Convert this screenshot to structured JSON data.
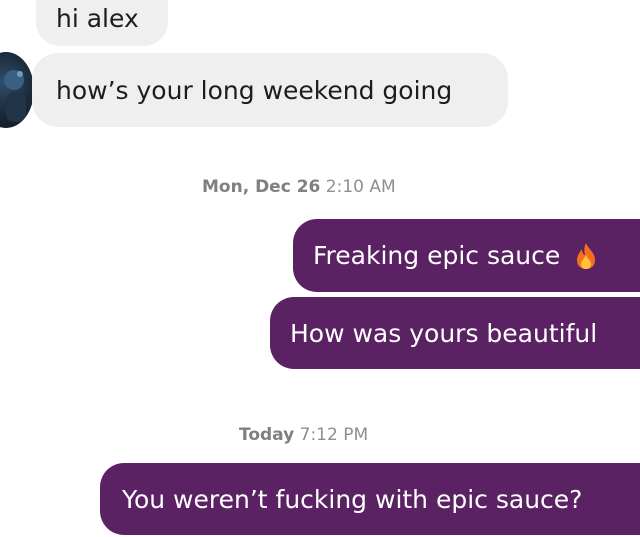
{
  "conversation": {
    "incoming": [
      {
        "text": "hi alex"
      },
      {
        "text": "how’s your long weekend going"
      }
    ],
    "timestamp_1": {
      "day": "Mon, Dec 26",
      "time": "2:10 AM"
    },
    "outgoing_1": [
      {
        "text": "Freaking epic sauce",
        "emoji": "🔥"
      },
      {
        "text": "How was yours beautiful"
      }
    ],
    "timestamp_2": {
      "day": "Today",
      "time": "7:12 PM"
    },
    "outgoing_2": [
      {
        "text": "You weren’t fucking with epic sauce?"
      }
    ]
  },
  "colors": {
    "incoming_bubble": "#efeff0",
    "outgoing_bubble": "#5b2263",
    "timestamp_text": "#8e8e93"
  },
  "icons": {
    "avatar": "contact-avatar",
    "emoji": "fire-emoji-icon"
  }
}
